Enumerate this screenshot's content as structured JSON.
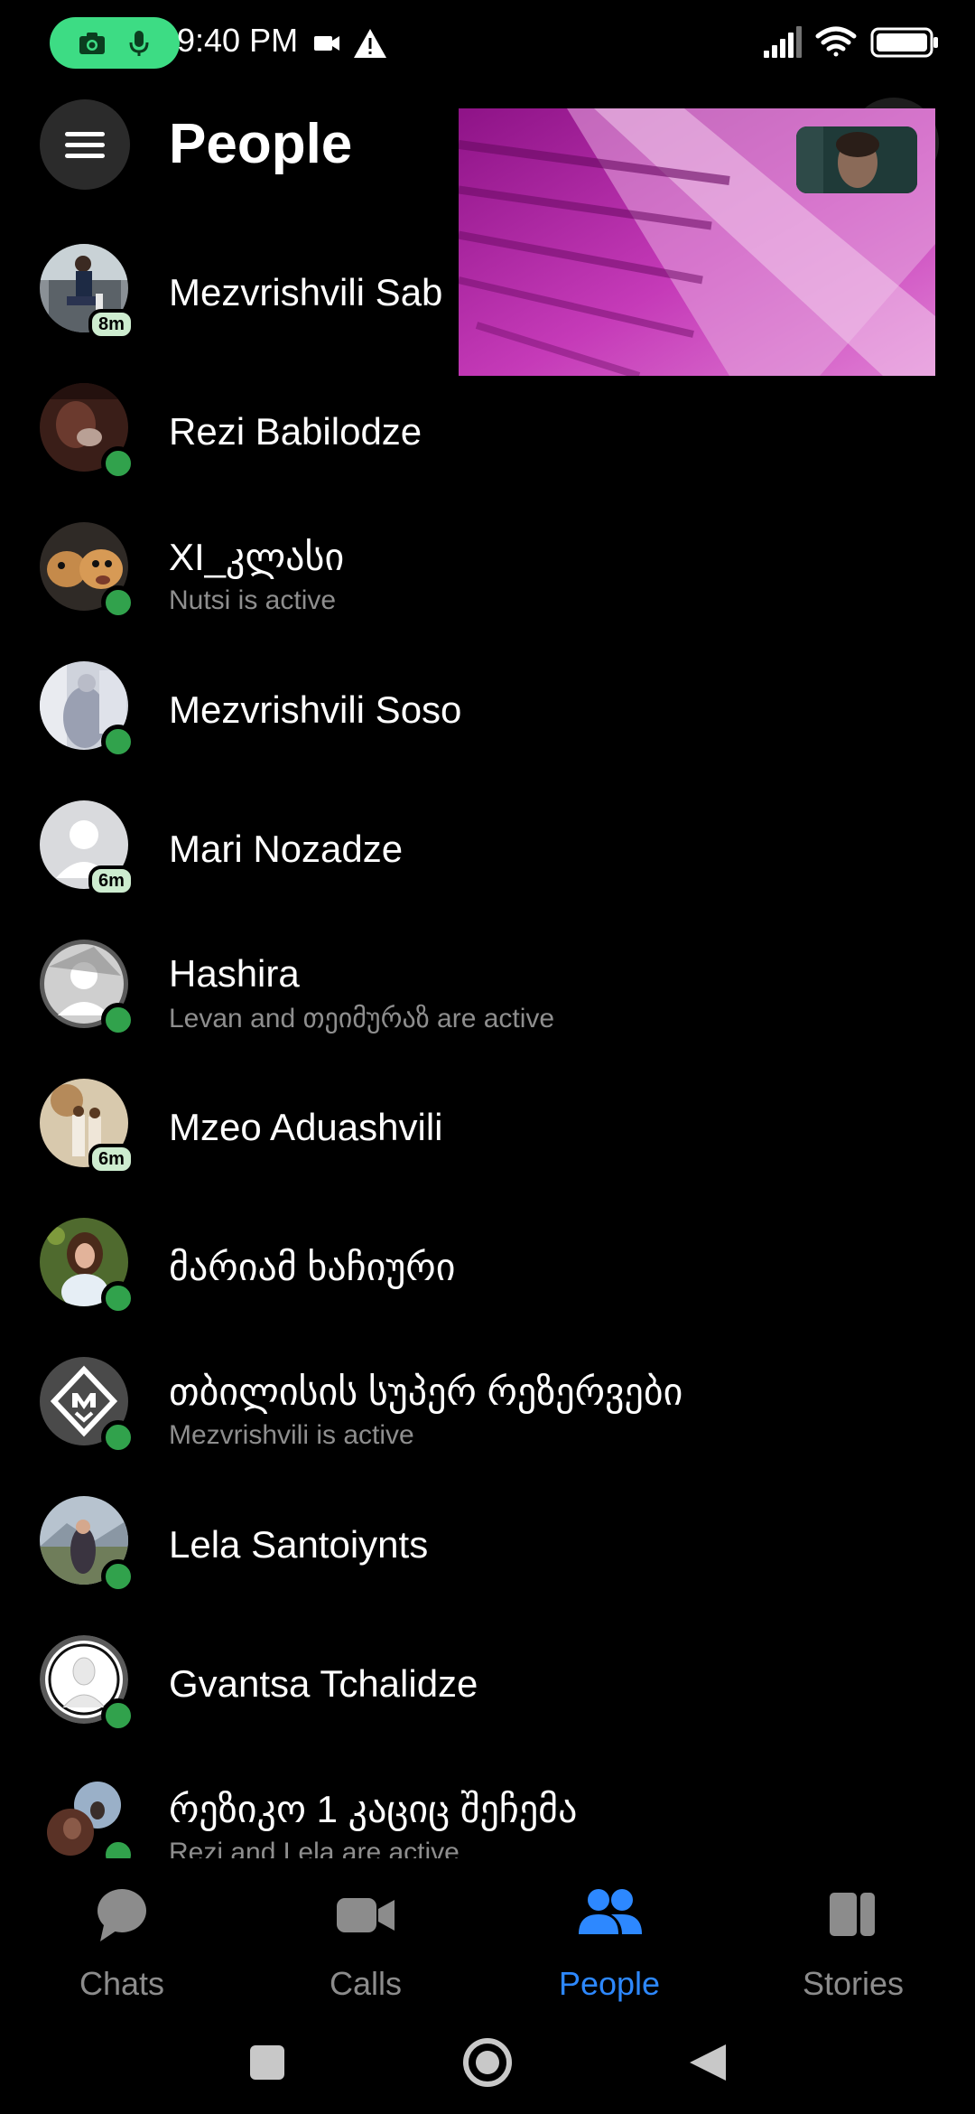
{
  "status_bar": {
    "time": "9:40 PM"
  },
  "header": {
    "title": "People"
  },
  "people": [
    {
      "name": "Mezvrishvili Sab",
      "badge": "8m",
      "status": "recent"
    },
    {
      "name": "Rezi Babilodze",
      "status": "online"
    },
    {
      "name": "XI_კლასი",
      "subtitle": "Nutsi is active",
      "status": "online"
    },
    {
      "name": "Mezvrishvili Soso",
      "status": "online"
    },
    {
      "name": "Mari Nozadze",
      "badge": "6m",
      "status": "recent"
    },
    {
      "name": "Hashira",
      "subtitle": "Levan and თეიმურაზ are active",
      "status": "online"
    },
    {
      "name": "Mzeo Aduashvili",
      "badge": "6m",
      "status": "recent"
    },
    {
      "name": "მარიამ ხაჩიური",
      "status": "online"
    },
    {
      "name": "თბილისის სუპერ რეზერვები",
      "subtitle": "Mezvrishvili is active",
      "status": "online"
    },
    {
      "name": "Lela Santoiynts",
      "status": "online"
    },
    {
      "name": "Gvantsa Tchalidze",
      "status": "online"
    },
    {
      "name": "რეზიკო 1 კაციც შეჩემა",
      "subtitle": "Rezi and Lela are active",
      "status": "online"
    }
  ],
  "bottom_nav": {
    "tabs": [
      {
        "label": "Chats",
        "icon": "chat-bubble-icon"
      },
      {
        "label": "Calls",
        "icon": "video-camera-icon"
      },
      {
        "label": "People",
        "icon": "people-icon",
        "active": true
      },
      {
        "label": "Stories",
        "icon": "stories-icon"
      }
    ]
  },
  "colors": {
    "background": "#000000",
    "accent": "#2d88ff",
    "online": "#31a24c",
    "recording_pill": "#3ddc84",
    "inactive_nav": "#8c8c8c",
    "subtitle": "#8e8e8e"
  }
}
